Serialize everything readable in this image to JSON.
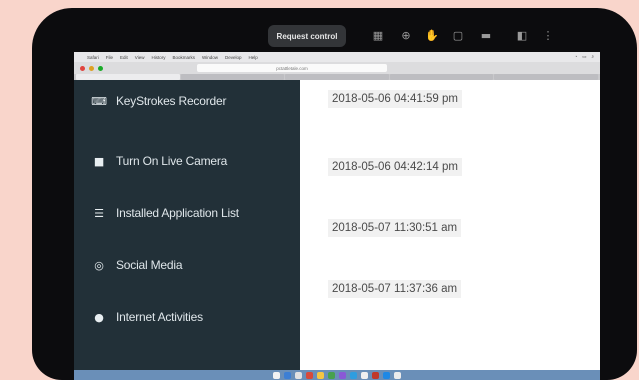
{
  "toolbar": {
    "request_control_label": "Request control"
  },
  "browser": {
    "menu_items": [
      "Safari",
      "File",
      "Edit",
      "View",
      "History",
      "Bookmarks",
      "Window",
      "Develop",
      "Help"
    ],
    "url": "pctattletale.com"
  },
  "sidebar": {
    "items": [
      {
        "label": "KeyStrokes Recorder",
        "icon": "keyboard-icon"
      },
      {
        "label": "Turn On Live Camera",
        "icon": "camera-icon"
      },
      {
        "label": "Installed Application List",
        "icon": "list-icon"
      },
      {
        "label": "Social Media",
        "icon": "globe-icon"
      },
      {
        "label": "Internet Activities",
        "icon": "world-icon"
      }
    ]
  },
  "main": {
    "timestamps": [
      "2018-05-06 04:41:59 pm",
      "2018-05-06 04:42:14 pm",
      "2018-05-07 11:30:51 am",
      "2018-05-07 11:37:36 am"
    ]
  },
  "colors": {
    "sidebar_bg": "#223038",
    "page_bg": "#f9d5cb",
    "frame_bg": "#0c0c0e"
  }
}
